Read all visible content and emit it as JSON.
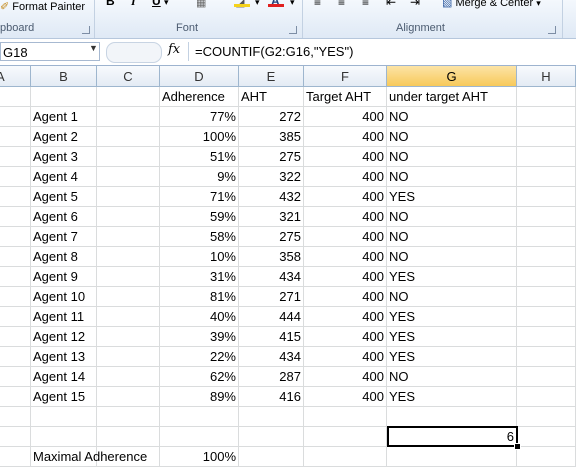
{
  "ribbon": {
    "format_painter_label": "Format Painter",
    "clipboard_group": "pboard",
    "font_group": "Font",
    "alignment_group": "Alignment",
    "merge_center_label": "Merge & Center",
    "bold": "B",
    "italic": "I",
    "underline": "U",
    "font_color_glyph": "A",
    "fill_color": "#f5d21b",
    "font_color": "#e02020"
  },
  "formula_bar": {
    "cell_ref": "G18",
    "fx": "fx",
    "formula": "=COUNTIF(G2:G16,\"YES\")"
  },
  "columns": [
    "A",
    "B",
    "C",
    "D",
    "E",
    "F",
    "G",
    "H"
  ],
  "headers": {
    "d": "Adherence",
    "e": "AHT",
    "f": "Target AHT",
    "g": "under target AHT"
  },
  "rows": [
    {
      "agent": "Agent 1",
      "adherence": "77%",
      "aht": "272",
      "target": "400",
      "under": "NO"
    },
    {
      "agent": "Agent 2",
      "adherence": "100%",
      "aht": "385",
      "target": "400",
      "under": "NO"
    },
    {
      "agent": "Agent 3",
      "adherence": "51%",
      "aht": "275",
      "target": "400",
      "under": "NO"
    },
    {
      "agent": "Agent 4",
      "adherence": "9%",
      "aht": "322",
      "target": "400",
      "under": "NO"
    },
    {
      "agent": "Agent 5",
      "adherence": "71%",
      "aht": "432",
      "target": "400",
      "under": "YES"
    },
    {
      "agent": "Agent 6",
      "adherence": "59%",
      "aht": "321",
      "target": "400",
      "under": "NO"
    },
    {
      "agent": "Agent 7",
      "adherence": "58%",
      "aht": "275",
      "target": "400",
      "under": "NO"
    },
    {
      "agent": "Agent 8",
      "adherence": "10%",
      "aht": "358",
      "target": "400",
      "under": "NO"
    },
    {
      "agent": "Agent 9",
      "adherence": "31%",
      "aht": "434",
      "target": "400",
      "under": "YES"
    },
    {
      "agent": "Agent 10",
      "adherence": "81%",
      "aht": "271",
      "target": "400",
      "under": "NO"
    },
    {
      "agent": "Agent 11",
      "adherence": "40%",
      "aht": "444",
      "target": "400",
      "under": "YES"
    },
    {
      "agent": "Agent 12",
      "adherence": "39%",
      "aht": "415",
      "target": "400",
      "under": "YES"
    },
    {
      "agent": "Agent 13",
      "adherence": "22%",
      "aht": "434",
      "target": "400",
      "under": "YES"
    },
    {
      "agent": "Agent 14",
      "adherence": "62%",
      "aht": "287",
      "target": "400",
      "under": "NO"
    },
    {
      "agent": "Agent 15",
      "adherence": "89%",
      "aht": "416",
      "target": "400",
      "under": "YES"
    }
  ],
  "result_cell_value": "6",
  "footer": {
    "label": "Maximal Adherence",
    "value": "100%"
  }
}
